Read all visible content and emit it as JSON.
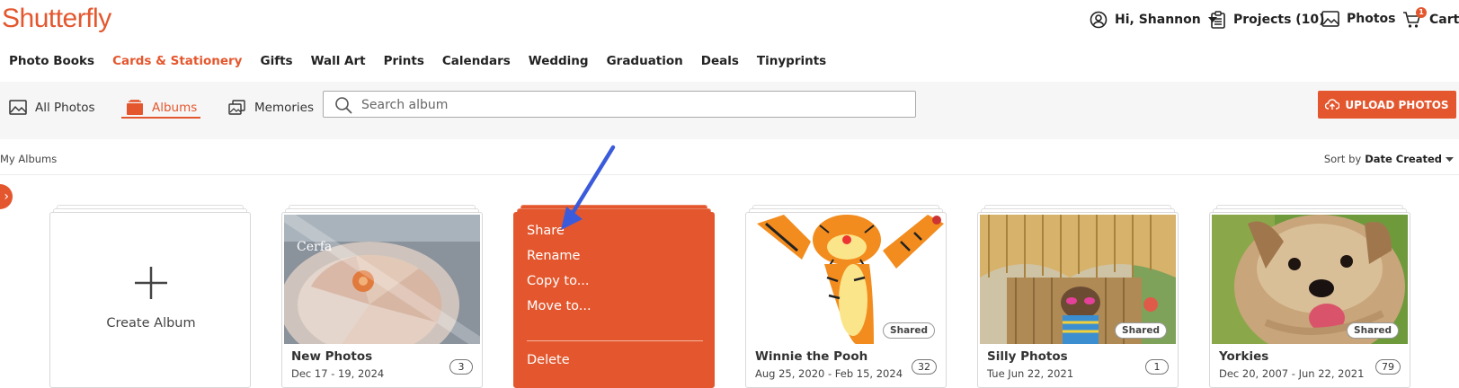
{
  "brand": {
    "name": "Shutterfly",
    "accent": "#e4572e"
  },
  "header": {
    "greeting": "Hi, Shannon",
    "projects": "Projects (10)",
    "photos": "Photos",
    "cart": "Cart",
    "cart_count": "1"
  },
  "nav": [
    "Photo Books",
    "Cards & Stationery",
    "Gifts",
    "Wall Art",
    "Prints",
    "Calendars",
    "Wedding",
    "Graduation",
    "Deals",
    "Tinyprints"
  ],
  "tabs": {
    "all_photos": "All Photos",
    "albums": "Albums",
    "memories": "Memories"
  },
  "search": {
    "placeholder": "Search album"
  },
  "upload_label": "UPLOAD PHOTOS",
  "breadcrumb": "My Albums",
  "sort": {
    "prefix": "Sort by",
    "value": "Date Created"
  },
  "create_album": "Create Album",
  "albums": [
    {
      "title": "New Photos",
      "date": "Dec 17 - 19, 2024",
      "count": "3",
      "shared": ""
    },
    {
      "title": "Winnie the Pooh",
      "date": "Aug 25, 2020 - Feb 15, 2024",
      "count": "32",
      "shared": "Shared"
    },
    {
      "title": "Silly Photos",
      "date": "Tue Jun 22, 2021",
      "count": "1",
      "shared": "Shared"
    },
    {
      "title": "Yorkies",
      "date": "Dec 20, 2007 - Jun 22, 2021",
      "count": "79",
      "shared": "Shared"
    }
  ],
  "context_menu": {
    "items": [
      "Share",
      "Rename",
      "Copy to...",
      "Move to..."
    ],
    "danger": "Delete"
  },
  "thumb_text": {
    "cerfa": "Cerfa"
  }
}
